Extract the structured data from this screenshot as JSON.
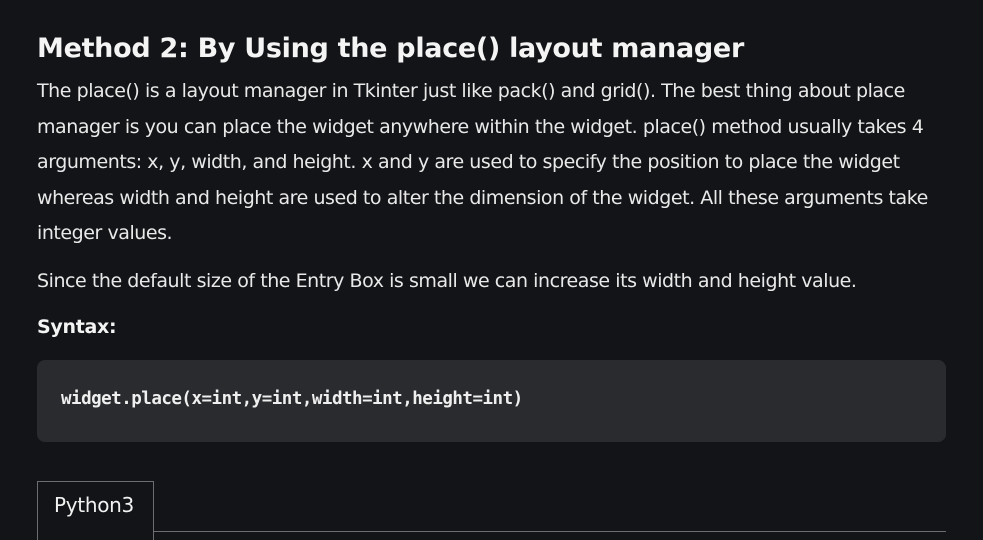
{
  "article": {
    "heading": "Method 2: By Using the place() layout manager",
    "paragraph_1": "The place() is a layout manager in Tkinter just like pack() and grid(). The best thing about place manager is you can place the widget anywhere within the widget. place() method usually takes 4 arguments: x, y, width, and height. x and y are used to specify the position to place the widget whereas width and height are used to alter the dimension of the widget. All these arguments take integer values.",
    "paragraph_2": "Since the default size of the Entry Box is small we can increase its width and height value.",
    "syntax_label": "Syntax:",
    "code": "widget.place(x=int,y=int,width=int,height=int)"
  },
  "code_tabs": {
    "active_tab": "Python3"
  },
  "colors": {
    "background": "#131417",
    "code_background": "#2a2b2e",
    "text": "#f2f2f2",
    "tab_border": "#6b6d72"
  }
}
